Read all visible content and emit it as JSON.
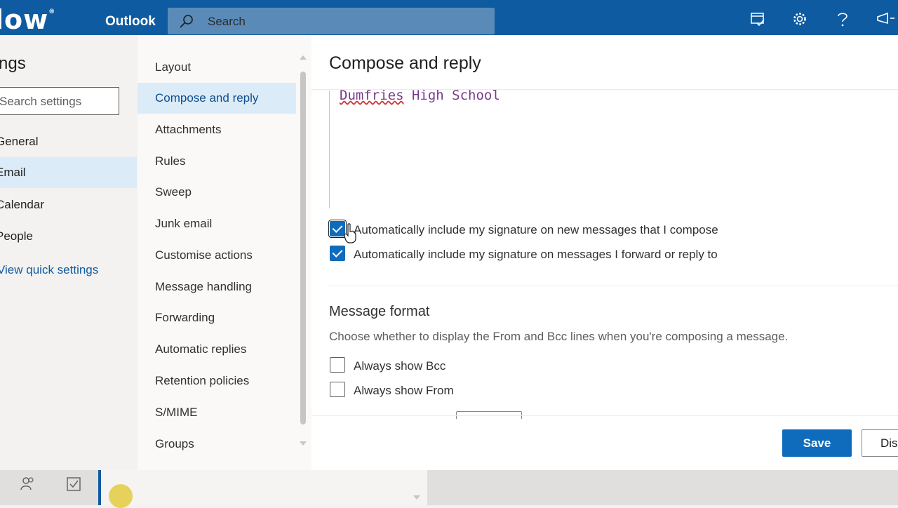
{
  "topbar": {
    "brand": "low",
    "brand_mark": "®",
    "app_name": "Outlook",
    "search_placeholder": "Search",
    "icons": [
      "my-day-icon",
      "settings-gear-icon",
      "help-icon",
      "feedback-megaphone-icon"
    ]
  },
  "settings": {
    "title": "ngs",
    "search_placeholder": "Search settings",
    "categories": [
      {
        "label": "General",
        "selected": false
      },
      {
        "label": "Email",
        "selected": true
      },
      {
        "label": "Calendar",
        "selected": false
      },
      {
        "label": "People",
        "selected": false
      }
    ],
    "quick_settings_link": "View quick settings"
  },
  "email_nav": {
    "items": [
      {
        "label": "Layout",
        "selected": false
      },
      {
        "label": "Compose and reply",
        "selected": true
      },
      {
        "label": "Attachments",
        "selected": false
      },
      {
        "label": "Rules",
        "selected": false
      },
      {
        "label": "Sweep",
        "selected": false
      },
      {
        "label": "Junk email",
        "selected": false
      },
      {
        "label": "Customise actions",
        "selected": false
      },
      {
        "label": "Message handling",
        "selected": false
      },
      {
        "label": "Forwarding",
        "selected": false
      },
      {
        "label": "Automatic replies",
        "selected": false
      },
      {
        "label": "Retention policies",
        "selected": false
      },
      {
        "label": "S/MIME",
        "selected": false
      },
      {
        "label": "Groups",
        "selected": false
      }
    ]
  },
  "compose": {
    "heading": "Compose and reply",
    "signature": {
      "word1": "Dumfries",
      "rest": " High School"
    },
    "options": [
      {
        "label": "Automatically include my signature on new messages that I compose",
        "checked": true
      },
      {
        "label": "Automatically include my signature on messages I forward or reply to",
        "checked": true
      }
    ],
    "message_format": {
      "title": "Message format",
      "description": "Choose whether to display the From and Bcc lines when you're composing a message.",
      "options": [
        {
          "label": "Always show Bcc",
          "checked": false
        },
        {
          "label": "Always show From",
          "checked": false
        }
      ]
    },
    "save_label": "Save",
    "discard_label": "Dis"
  },
  "colors": {
    "brand_blue": "#0f5ba1",
    "primary_button": "#0f6cbd",
    "selection": "#dcebf8",
    "signature": "#7a3a8a"
  }
}
